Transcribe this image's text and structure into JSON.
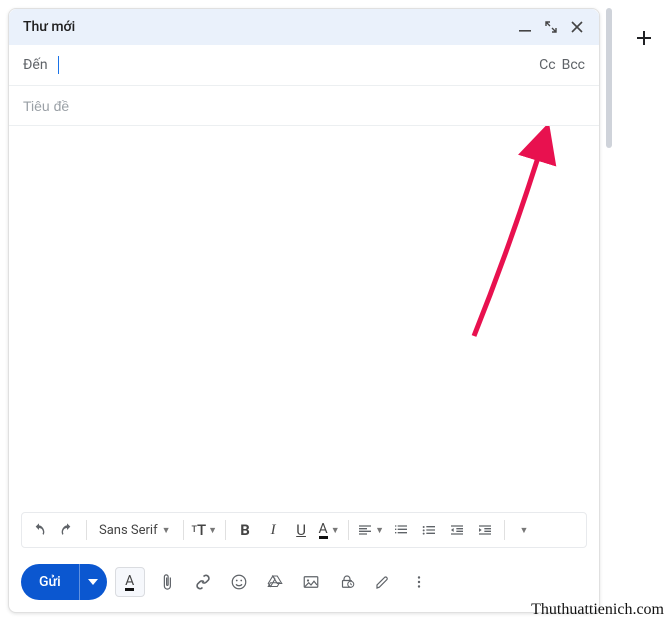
{
  "header": {
    "title": "Thư mới"
  },
  "recipients": {
    "toLabel": "Đến",
    "ccLabel": "Cc",
    "bccLabel": "Bcc"
  },
  "subject": {
    "placeholder": "Tiêu đề"
  },
  "toolbar": {
    "fontFamily": "Sans Serif"
  },
  "send": {
    "label": "Gửi"
  },
  "watermark": "Thuthuattienich.com",
  "icons": {
    "minimize": "minimize-icon",
    "expand": "expand-icon",
    "close": "close-icon",
    "undo": "undo-icon",
    "redo": "redo-icon",
    "fontSize": "font-size-icon",
    "bold": "bold-icon",
    "italic": "italic-icon",
    "underline": "underline-icon",
    "textColor": "text-color-icon",
    "align": "align-icon",
    "numList": "numbered-list-icon",
    "bulList": "bulleted-list-icon",
    "indentDec": "indent-decrease-icon",
    "indentInc": "indent-increase-icon",
    "more": "more-icon",
    "formatToggle": "format-toggle-icon",
    "attach": "attach-icon",
    "link": "link-icon",
    "emoji": "emoji-icon",
    "drive": "drive-icon",
    "image": "image-icon",
    "confidential": "confidential-icon",
    "signature": "signature-icon",
    "overflow": "overflow-icon",
    "plus": "plus-icon"
  }
}
